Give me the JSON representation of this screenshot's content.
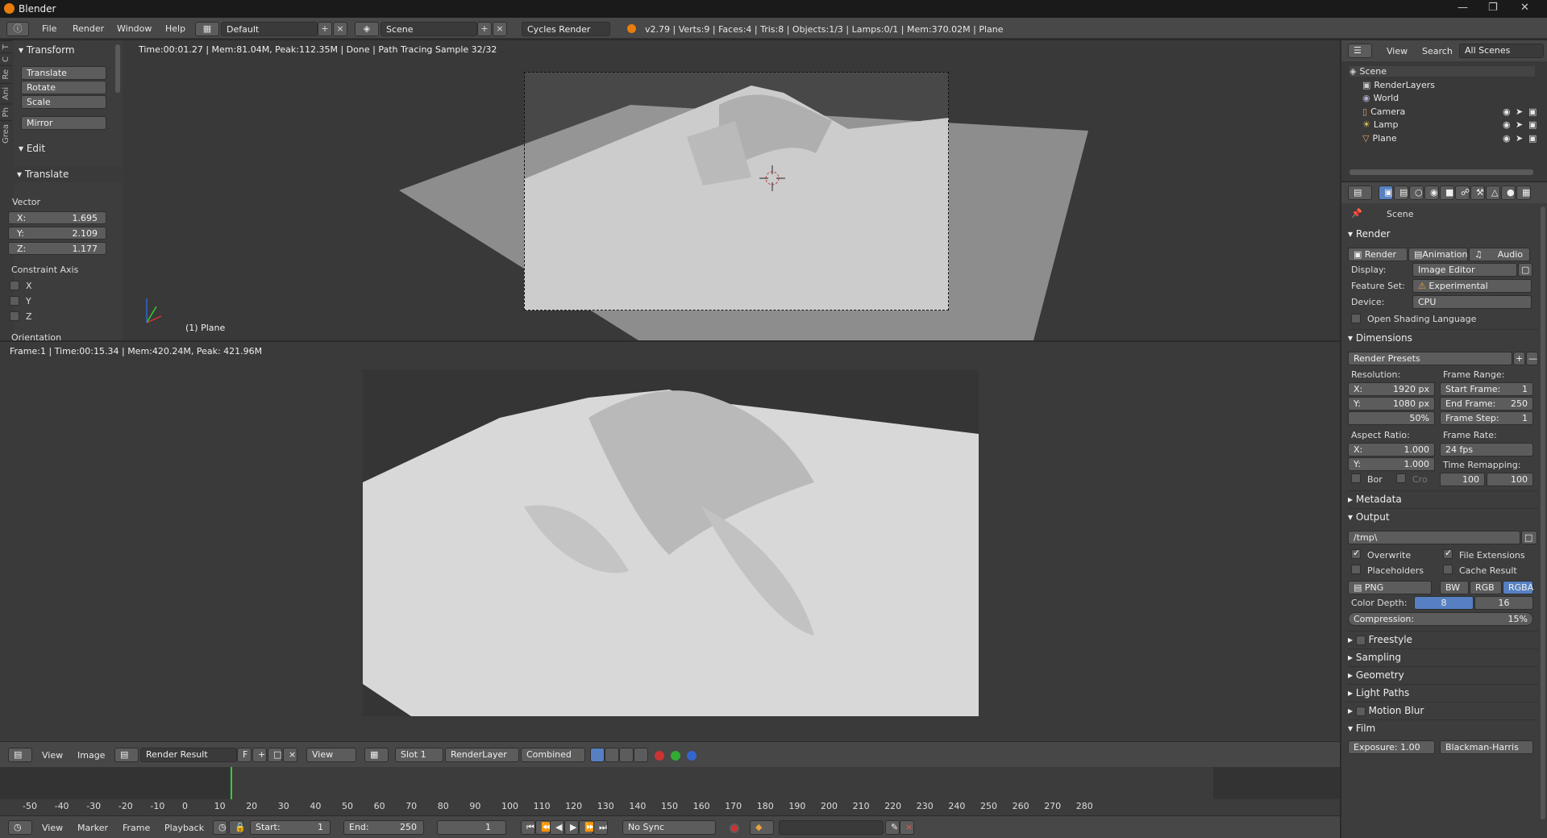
{
  "window": {
    "title": "Blender"
  },
  "info_header": {
    "menus": [
      "File",
      "Render",
      "Window",
      "Help"
    ],
    "layout": "Default",
    "scene": "Scene",
    "engine": "Cycles Render",
    "stats": "v2.79 | Verts:9 | Faces:4 | Tris:8 | Objects:1/3 | Lamps:0/1 | Mem:370.02M | Plane"
  },
  "toolshelf": {
    "tabs": [
      "T",
      "C",
      "Re",
      "Ani",
      "Ph",
      "Grea"
    ],
    "transform_title": "Transform",
    "transform_buttons": [
      "Translate",
      "Rotate",
      "Scale"
    ],
    "mirror": "Mirror",
    "edit_title": "Edit",
    "op_title": "Translate",
    "vector_label": "Vector",
    "vector": [
      {
        "axis": "X:",
        "value": "1.695"
      },
      {
        "axis": "Y:",
        "value": "2.109"
      },
      {
        "axis": "Z:",
        "value": "1.177"
      }
    ],
    "constraint_label": "Constraint Axis",
    "constraint_axes": [
      "X",
      "Y",
      "Z"
    ],
    "orientation_label": "Orientation"
  },
  "viewport": {
    "info": "Time:00:01.27 | Mem:81.04M, Peak:112.35M | Done | Path Tracing Sample 32/32",
    "object_label": "(1) Plane"
  },
  "render_view": {
    "info": "Frame:1 | Time:00:15.34 | Mem:420.24M, Peak: 421.96M",
    "header": {
      "menus": [
        "View",
        "Image"
      ],
      "image_name": "Render Result",
      "f_label": "F",
      "view": "View",
      "slot": "Slot 1",
      "layer": "RenderLayer",
      "pass": "Combined"
    }
  },
  "timeline": {
    "ticks": [
      "-50",
      "-40",
      "-30",
      "-20",
      "-10",
      "0",
      "10",
      "20",
      "30",
      "40",
      "50",
      "60",
      "70",
      "80",
      "90",
      "100",
      "110",
      "120",
      "130",
      "140",
      "150",
      "160",
      "170",
      "180",
      "190",
      "200",
      "210",
      "220",
      "230",
      "240",
      "250",
      "260",
      "270",
      "280"
    ],
    "current_frame": 1,
    "menus": [
      "View",
      "Marker",
      "Frame",
      "Playback"
    ],
    "start_label": "Start:",
    "start": "1",
    "end_label": "End:",
    "end": "250",
    "frame": "1",
    "sync": "No Sync"
  },
  "outliner": {
    "menus": [
      "View",
      "Search"
    ],
    "filter": "All Scenes",
    "items": [
      {
        "label": "Scene",
        "indent": 0
      },
      {
        "label": "RenderLayers",
        "indent": 1
      },
      {
        "label": "World",
        "indent": 1
      },
      {
        "label": "Camera",
        "indent": 1
      },
      {
        "label": "Lamp",
        "indent": 1
      },
      {
        "label": "Plane",
        "indent": 1
      }
    ]
  },
  "properties": {
    "context": "Scene",
    "render_panel": "Render",
    "render_buttons": [
      "Render",
      "Animation",
      "Audio"
    ],
    "display_label": "Display:",
    "display": "Image Editor",
    "feature_label": "Feature Set:",
    "feature": "Experimental",
    "device_label": "Device:",
    "device": "CPU",
    "osl": "Open Shading Language",
    "dimensions": "Dimensions",
    "render_presets": "Render Presets",
    "resolution_label": "Resolution:",
    "res_x_label": "X:",
    "res_x": "1920 px",
    "res_y_label": "Y:",
    "res_y": "1080 px",
    "res_pct": "50%",
    "frame_range_label": "Frame Range:",
    "start_frame_label": "Start Frame:",
    "start_frame": "1",
    "end_frame_label": "End Frame:",
    "end_frame": "250",
    "frame_step_label": "Frame Step:",
    "frame_step": "1",
    "aspect_label": "Aspect Ratio:",
    "aspect_x_label": "X:",
    "aspect_x": "1.000",
    "aspect_y_label": "Y:",
    "aspect_y": "1.000",
    "frame_rate_label": "Frame Rate:",
    "frame_rate": "24 fps",
    "time_remap_label": "Time Remapping:",
    "remap_old": "100",
    "remap_new": "100",
    "border": "Bor",
    "crop": "Cro",
    "metadata": "Metadata",
    "output": "Output",
    "output_path": "/tmp\\",
    "overwrite": "Overwrite",
    "file_ext": "File Extensions",
    "placeholders": "Placeholders",
    "cache": "Cache Result",
    "format": "PNG",
    "color_modes": [
      "BW",
      "RGB",
      "RGBA"
    ],
    "color_depth_label": "Color Depth:",
    "depths": [
      "8",
      "16"
    ],
    "compression_label": "Compression:",
    "compression": "15%",
    "panels": [
      "Freestyle",
      "Sampling",
      "Geometry",
      "Light Paths",
      "Motion Blur",
      "Film"
    ],
    "exposure": "Exposure: 1.00",
    "filter": "Blackman-Harris"
  }
}
